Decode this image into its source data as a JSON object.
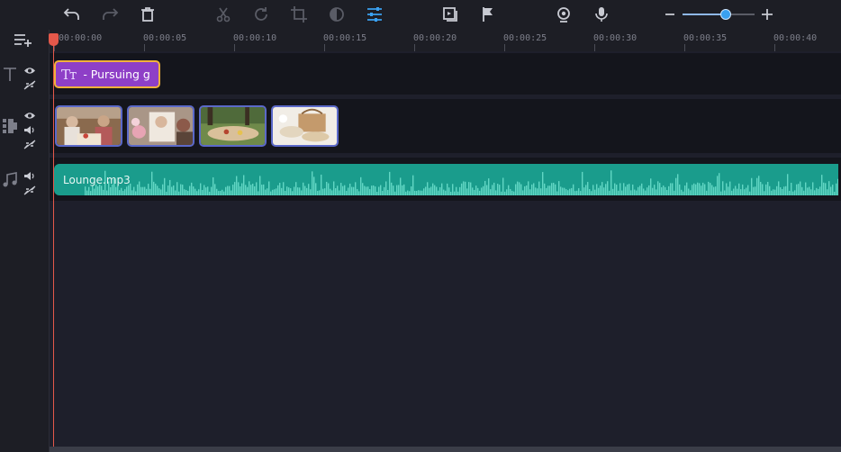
{
  "toolbar": {
    "undo": "undo-icon",
    "redo": "redo-icon",
    "delete": "trash-icon",
    "cut": "scissors-icon",
    "rotate": "rotate-icon",
    "crop": "crop-icon",
    "color": "color-adjust-icon",
    "clip_properties": "sliders-icon",
    "insert": "insert-icon",
    "marker": "flag-icon",
    "webcam": "webcam-icon",
    "mic": "microphone-icon",
    "zoom_out": "minus-icon",
    "zoom_in": "plus-icon",
    "zoom_level": 0.6,
    "accent": "#3aa0f0"
  },
  "ruler": {
    "labels": [
      "00:00:00",
      "00:00:05",
      "00:00:10",
      "00:00:15",
      "00:00:20",
      "00:00:25",
      "00:00:30",
      "00:00:35",
      "00:00:40"
    ]
  },
  "tracks": {
    "title": {
      "icon": "text-icon",
      "clip_icon": "Tᴛ",
      "clip_text": "- Pursuing g",
      "color": "#8e3fc7",
      "border": "#f2b13b"
    },
    "video": {
      "icon": "film-icon",
      "clips": [
        "picnic-people-photo",
        "picnic-flowers-photo",
        "picnic-park-photo",
        "picnic-basket-photo"
      ]
    },
    "audio": {
      "icon": "music-note-icon",
      "clip_name": "Lounge.mp3",
      "color": "#1a9c8c"
    }
  },
  "playhead": {
    "time": "00:00:00",
    "color": "#e4584a"
  }
}
